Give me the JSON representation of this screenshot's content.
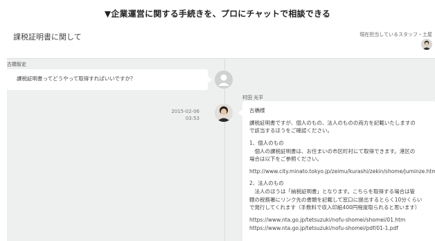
{
  "caption": "▼企業運営に関する手続きを、プロにチャットで相談できる",
  "chat": {
    "title": "課税証明書に関して",
    "staff_label": "現在担当しているスタッフ・土屋"
  },
  "messages": [
    {
      "sender": "古橋智史",
      "text": "課税証明書ってどうやって取得すればいいですか？"
    },
    {
      "sender": "村田 光平",
      "date": "2015-02-06",
      "time": "03:53",
      "lines": [
        "古橋様",
        "課税証明書ですが、個人のもの、法人のものの両方を記載いたしますの",
        "で該当するほうをご確認ください。",
        "1、個人のもの",
        "　個人の課税証明書は、お住まいの市区町村にて取得できます。港区の",
        "場合は以下をご参照ください。",
        "http://www.city.minato.tokyo.jp/zeimu/kurashi/zekin/shome/juminze.html",
        "2、法人のもの",
        "　法人のほうは「納税証明書」となります。こちらを取得する場合は管",
        "轄の税務署にリンク先の書類を記載して窓口に提出するとらく10分くらい",
        "で発行してくれます（手数料で収入印紙400円程度取られると思います）",
        "https://www.nta.go.jp/tetsuzuki/nofu-shomei/shomei/01.htm",
        "https://www.nta.go.jp/tetsuzuki/nofu-shomei/pdf/01-1.pdf"
      ]
    }
  ],
  "icons": {
    "header_avatar": "staff-avatar-icon",
    "placeholder_avatar": "user-placeholder-icon",
    "photo_avatar": "staff-photo-avatar-icon"
  }
}
